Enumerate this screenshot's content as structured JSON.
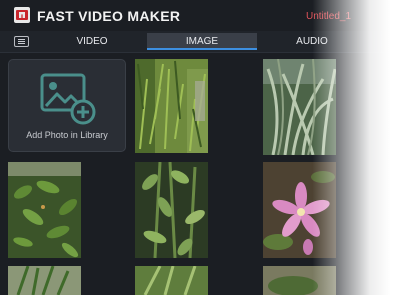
{
  "app": {
    "title": "FAST VIDEO MAKER",
    "project_name": "Untitled_1"
  },
  "tabs": [
    {
      "label": "VIDEO",
      "active": false
    },
    {
      "label": "IMAGE",
      "active": true
    },
    {
      "label": "AUDIO",
      "active": false
    }
  ],
  "library": {
    "add_label": "Add Photo in Library",
    "photos": [
      {
        "subject": "grass-ground"
      },
      {
        "subject": "spider-plant"
      },
      {
        "subject": "leafy-shrub"
      },
      {
        "subject": "stems-leaves"
      },
      {
        "subject": "pink-lily"
      },
      {
        "subject": "spiky-plant"
      },
      {
        "subject": "green-leaves"
      },
      {
        "subject": "bush"
      }
    ]
  },
  "colors": {
    "background": "#1b1e23",
    "accent": "#3d8fe0",
    "add_icon": "#4a8f8b",
    "project_name": "#e0535a"
  }
}
